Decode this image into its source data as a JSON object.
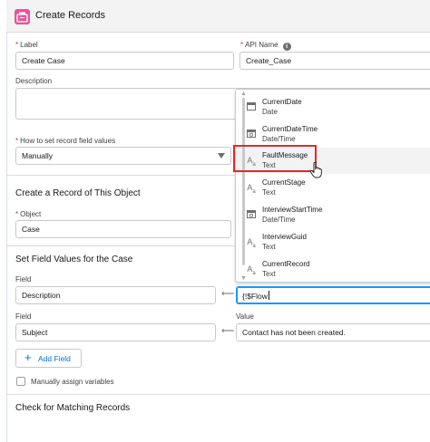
{
  "header": {
    "title": "Create Records",
    "icon": "records-icon",
    "icon_color": "#e3579a"
  },
  "form": {
    "label_label": "Label",
    "label_value": "Create Case",
    "api_label": "API Name",
    "api_value": "Create_Case",
    "description_label": "Description",
    "how_label": "How to set record field values",
    "how_value": "Manually"
  },
  "object_section": {
    "title": "Create a Record of This Object",
    "object_label": "Object",
    "object_value": "Case"
  },
  "field_values": {
    "title": "Set Field Values for the Case",
    "rows": [
      {
        "field_label": "Field",
        "field_value": "Description",
        "value_label": "",
        "value": "{!$Flow"
      },
      {
        "field_label": "Field",
        "field_value": "Subject",
        "value_label": "Value",
        "value": "Contact has not been created."
      }
    ],
    "add_field_label": "Add Field",
    "manual_assign_label": "Manually assign variables"
  },
  "matching": {
    "title": "Check for Matching Records"
  },
  "dropdown": {
    "items": [
      {
        "name": "CurrentDate",
        "type": "Date",
        "icon": "calendar-icon"
      },
      {
        "name": "CurrentDateTime",
        "type": "Date/Time",
        "icon": "calendar-clock-icon"
      },
      {
        "name": "FaultMessage",
        "type": "Text",
        "icon": "text-icon",
        "highlighted": true
      },
      {
        "name": "CurrentStage",
        "type": "Text",
        "icon": "text-icon"
      },
      {
        "name": "InterviewStartTime",
        "type": "Date/Time",
        "icon": "calendar-clock-icon"
      },
      {
        "name": "InterviewGuid",
        "type": "Text",
        "icon": "text-icon"
      },
      {
        "name": "CurrentRecord",
        "type": "Text",
        "icon": "text-icon"
      }
    ],
    "highlight_color": "#d72c2c"
  },
  "colors": {
    "accent": "#0176d3",
    "focus": "#1b96ff",
    "required": "#c23934"
  }
}
